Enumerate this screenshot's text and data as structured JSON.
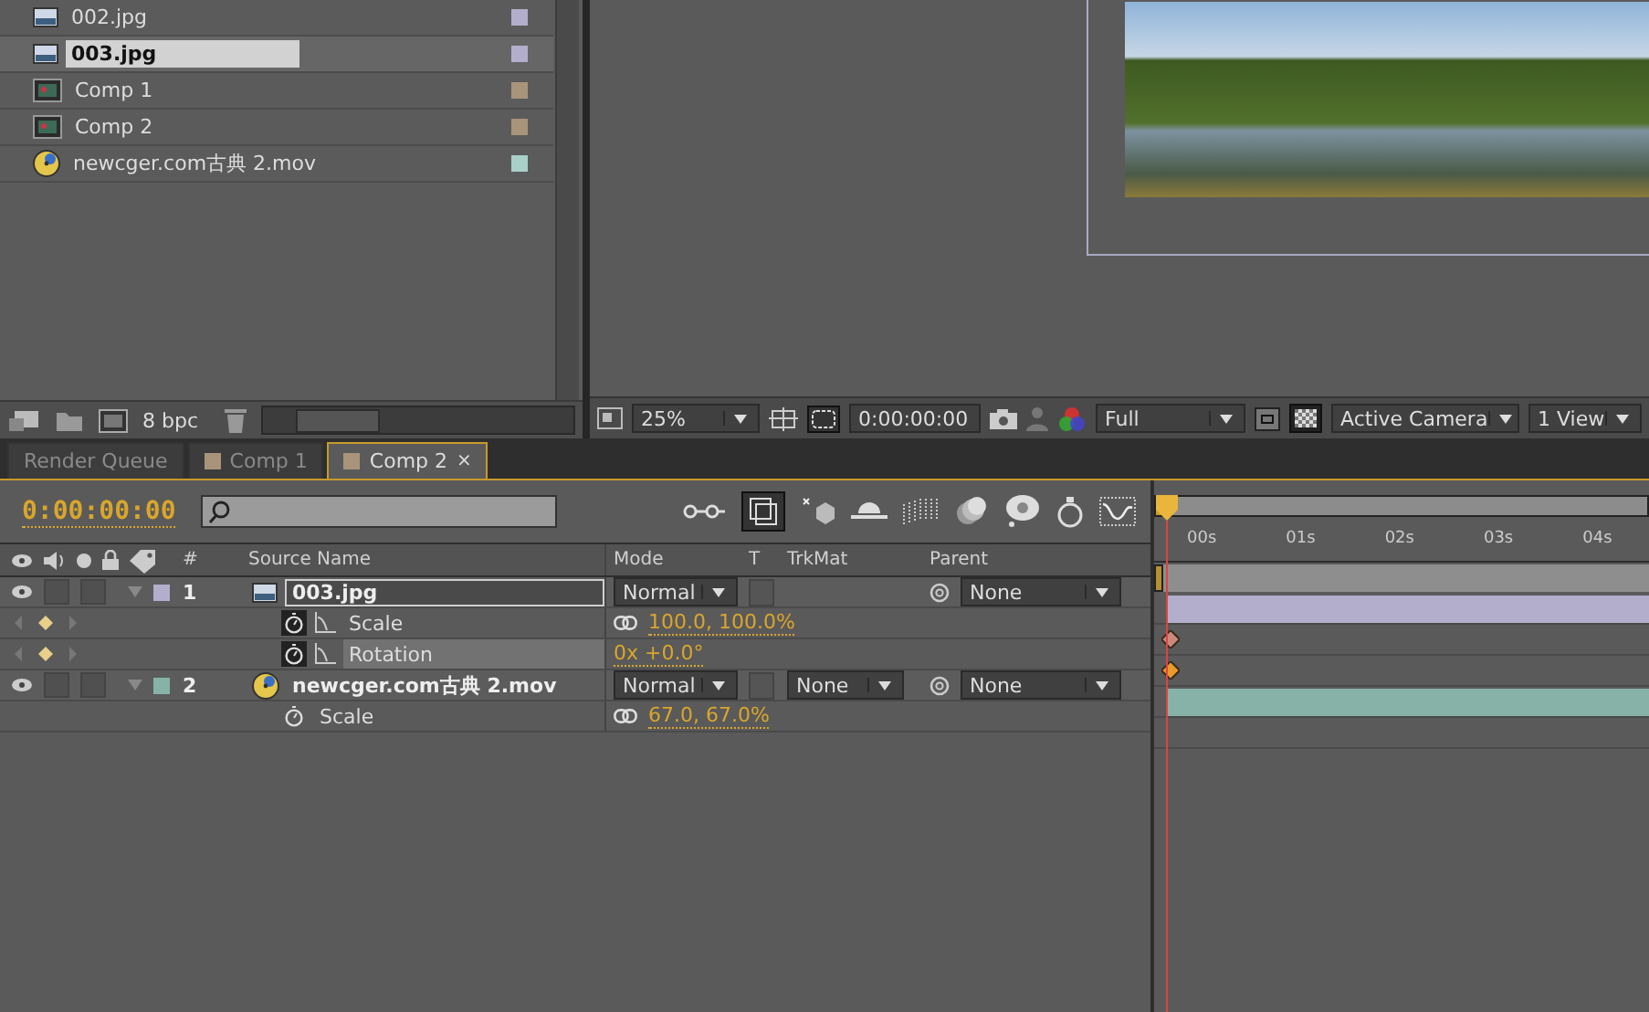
{
  "project": {
    "items": [
      {
        "name": "002.jpg",
        "kind": "image",
        "color": "#b3aecb",
        "selected": false
      },
      {
        "name": "003.jpg",
        "kind": "image",
        "color": "#b3aecb",
        "selected": true
      },
      {
        "name": "Comp 1",
        "kind": "comp",
        "color": "#a8947a",
        "selected": false
      },
      {
        "name": "Comp 2",
        "kind": "comp",
        "color": "#a8947a",
        "selected": false
      },
      {
        "name": "newcger.com古典 2.mov",
        "kind": "movie",
        "color": "#a9cfc9",
        "selected": false
      }
    ],
    "bit_depth": "8 bpc"
  },
  "viewer": {
    "zoom": "25%",
    "timecode": "0:00:00:00",
    "resolution": "Full",
    "camera": "Active Camera",
    "views": "1 View"
  },
  "tabs": [
    {
      "label": "Render Queue",
      "selected": false
    },
    {
      "label": "Comp 1",
      "color": "#a8947a",
      "selected": false
    },
    {
      "label": "Comp 2",
      "color": "#a8947a",
      "selected": true,
      "close": "×"
    }
  ],
  "timeline": {
    "timecode": "0:00:00:00",
    "columns": [
      "#",
      "Source Name",
      "Mode",
      "T",
      "TrkMat",
      "Parent"
    ],
    "ruler": [
      "00s",
      "01s",
      "02s",
      "03s",
      "04s"
    ],
    "layers": [
      {
        "index": "1",
        "name": "003.jpg",
        "kind": "image",
        "color": "#b3aecb",
        "visible": true,
        "solo": false,
        "locked": false,
        "preserve_transparency": false,
        "expanded": true,
        "selected": true,
        "mode": "Normal",
        "parent": "None",
        "properties": [
          {
            "name": "Scale",
            "value": "100.0, 100.0%",
            "linked": true,
            "stopwatch_on": true,
            "keyframe": true,
            "selected": false
          },
          {
            "name": "Rotation",
            "value": "0x +0.0°",
            "linked": false,
            "stopwatch_on": true,
            "keyframe": true,
            "selected": true
          }
        ]
      },
      {
        "index": "2",
        "name": "newcger.com古典 2.mov",
        "kind": "movie",
        "color": "#87b2a8",
        "visible": true,
        "solo": false,
        "locked": false,
        "preserve_transparency": false,
        "expanded": true,
        "selected": false,
        "mode": "Normal",
        "trkmat": "None",
        "parent": "None",
        "properties": [
          {
            "name": "Scale",
            "value": "67.0, 67.0%",
            "linked": true,
            "stopwatch_on": false,
            "keyframe": false,
            "selected": false
          }
        ]
      }
    ]
  }
}
